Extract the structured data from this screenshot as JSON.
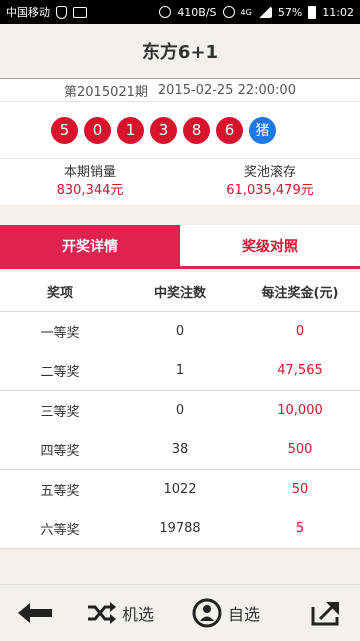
{
  "status_bar": {
    "carrier": "中国移动",
    "speed": "410B/S",
    "battery": "57%",
    "time": "11:02",
    "network": "4G"
  },
  "header": {
    "title": "东方6+1"
  },
  "issue": {
    "issue_no": "第2015021期",
    "datetime": "2015-02-25 22:00:00"
  },
  "balls": {
    "numbers": [
      "5",
      "0",
      "1",
      "3",
      "8",
      "6"
    ],
    "zodiac": "猪"
  },
  "stats": {
    "sales_label": "本期销量",
    "sales_value": "830,344元",
    "pool_label": "奖池滚存",
    "pool_value": "61,035,479元"
  },
  "tabs": {
    "active_label": "开奖详情",
    "inactive_label": "奖级对照"
  },
  "table": {
    "headers": [
      "奖项",
      "中奖注数",
      "每注奖金(元)"
    ],
    "rows": [
      {
        "level": "一等奖",
        "count": "0",
        "amount": "0"
      },
      {
        "level": "二等奖",
        "count": "1",
        "amount": "47,565"
      },
      {
        "level": "三等奖",
        "count": "0",
        "amount": "10,000"
      },
      {
        "level": "四等奖",
        "count": "38",
        "amount": "500"
      },
      {
        "level": "五等奖",
        "count": "1022",
        "amount": "50"
      },
      {
        "level": "六等奖",
        "count": "19788",
        "amount": "5"
      }
    ]
  },
  "toolbar": {
    "random_label": "机选",
    "self_label": "自选"
  },
  "colors": {
    "accent": "#e0224f",
    "ball_red": "#d7132e",
    "ball_blue": "#1e78e6"
  }
}
